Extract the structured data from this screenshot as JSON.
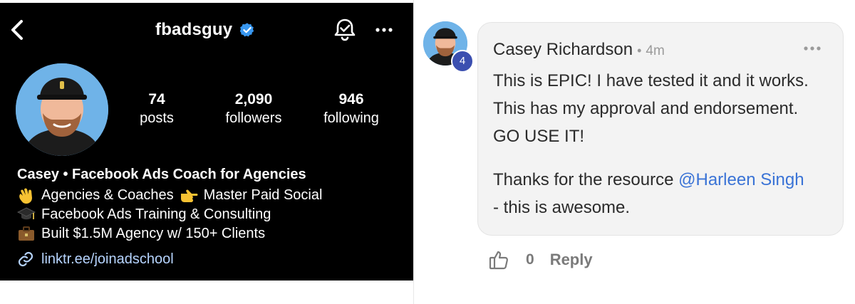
{
  "profile": {
    "username": "fbadsguy",
    "stats": [
      {
        "value": "74",
        "label": "posts"
      },
      {
        "value": "2,090",
        "label": "followers"
      },
      {
        "value": "946",
        "label": "following"
      }
    ],
    "bio": {
      "name_line": "Casey • Facebook Ads Coach for Agencies",
      "line1": "Agencies & Coaches",
      "line1b": "Master Paid Social",
      "line2": "Facebook Ads Training & Consulting",
      "line3": "Built $1.5M Agency w/ 150+ Clients"
    },
    "link": "linktr.ee/joinadschool"
  },
  "comment": {
    "author": "Casey Richardson",
    "separator": "•",
    "time": "4m",
    "level_badge": "4",
    "body_p1_l1": "This is EPIC! I have tested it and it works.",
    "body_p1_l2": "This has my approval and endorsement.",
    "body_p1_l3": "GO USE IT!",
    "body_p2_prefix": "Thanks for the resource ",
    "mention": "@Harleen Singh",
    "body_p2_suffix": "- this is awesome.",
    "likes": "0",
    "reply_label": "Reply"
  },
  "colors": {
    "profile_bg": "#000000",
    "mention": "#3a73d6",
    "link": "#b6d4ff",
    "verified": "#3897f0",
    "level_badge": "#3b4fb0"
  }
}
